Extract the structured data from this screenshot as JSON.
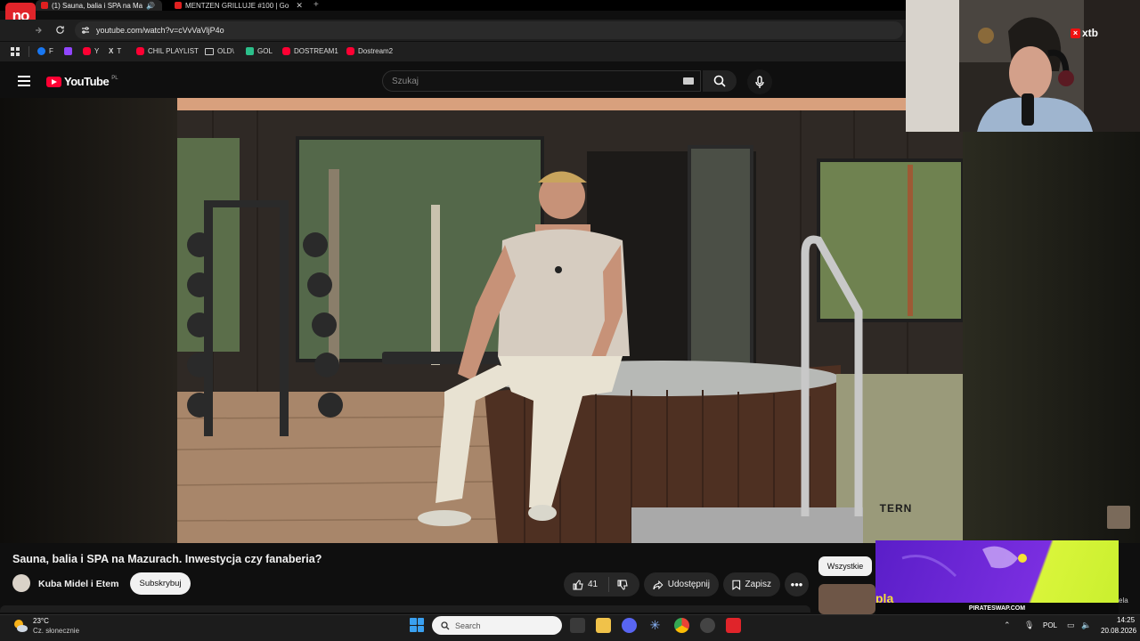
{
  "browser": {
    "tabs": [
      {
        "label": "(1) Sauna, balia i SPA na Ma",
        "active": true
      },
      {
        "label": "MENTZEN GRILLUJE #100 | Go",
        "active": false
      }
    ],
    "new_tab": "+",
    "close_glyph": "✕",
    "address": "youtube.com/watch?v=cVvVaVljP4o",
    "bookmarks": [
      "F",
      "Y",
      "T",
      "CHIL PLAYLIST",
      "OLD\\",
      "GOL",
      "DOSTREAM1",
      "Dostream2"
    ],
    "bookmark_colors": [
      "#1877f2",
      "#9146ff",
      "#ff0033",
      "#888888",
      "#ff0033",
      "#c9a35b",
      "#2bbf8a",
      "#ff0033",
      "#ff0033"
    ]
  },
  "stream_badge": "no",
  "youtube": {
    "logo_text": "YouTube",
    "region": "PL",
    "search_placeholder": "Szukaj",
    "video": {
      "title": "Sauna, balia i SPA na Mazurach. Inwestycja czy fanaberia?",
      "watermark": "TERN",
      "channel": "Kuba Midel i Etem",
      "subscribe": "Subskrybuj",
      "likes": "41",
      "share": "Udostępnij",
      "save": "Zapisz",
      "more": "•••"
    },
    "filter_chip": "Wszystkie"
  },
  "webcam": {
    "sponsor": "xtb"
  },
  "ad": {
    "logo_text": "pla",
    "caption": "PIRATESWAP.COM",
    "side_text": "ela"
  },
  "taskbar": {
    "weather_temp": "23°C",
    "weather_desc": "Cz. słonecznie",
    "search_placeholder": "Search",
    "language": "POL",
    "time": "14:25",
    "date": "20.08.2026"
  }
}
